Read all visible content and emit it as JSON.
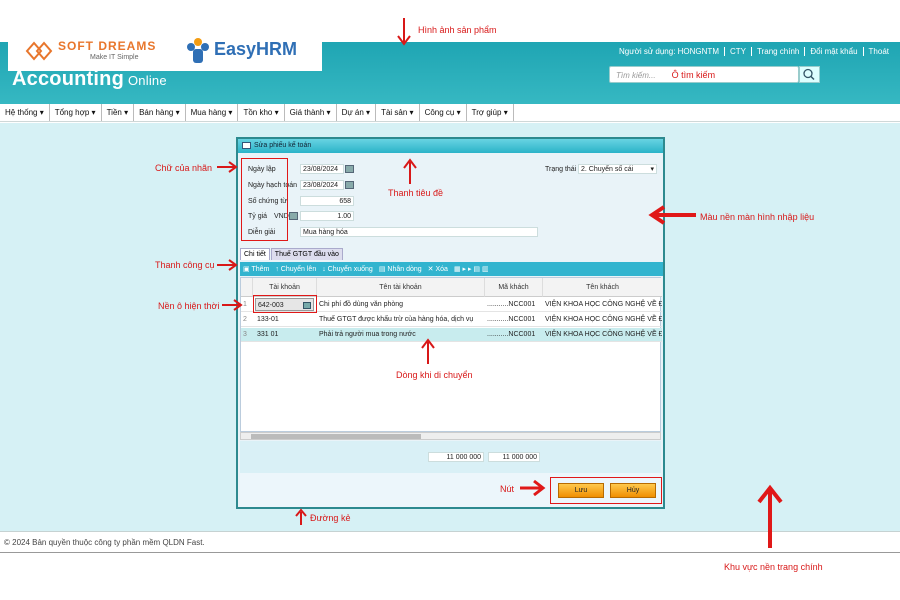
{
  "logos": {
    "softdreams_name": "SOFT DREAMS",
    "softdreams_tagline": "Make IT Simple",
    "easyhrm": "EasyHRM"
  },
  "header": {
    "app_title": "Accounting",
    "app_title_sub": "Online",
    "user_label": "Người sử dụng: HONGNTM",
    "links": [
      "CTY",
      "Trang chính",
      "Đổi mật khẩu",
      "Thoát"
    ],
    "search_placeholder": "Tìm kiếm...",
    "search_annotation_inline": "Ô tìm kiếm"
  },
  "menu": [
    "Hệ thống",
    "Tổng hợp",
    "Tiền",
    "Bán hàng",
    "Mua hàng",
    "Tồn kho",
    "Giá thành",
    "Dự án",
    "Tài sản",
    "Công cụ",
    "Trợ giúp"
  ],
  "dialog": {
    "title": "Sửa phiếu kế toán",
    "fields": {
      "ngay_lap_label": "Ngày lập",
      "ngay_lap": "23/08/2024",
      "ngay_hach_toan_label": "Ngày hạch toán",
      "ngay_hach_toan": "23/08/2024",
      "so_chung_tu_label": "Số chứng từ",
      "so_chung_tu": "658",
      "ty_gia_label": "Tỷ giá",
      "currency": "VND",
      "ty_gia": "1.00",
      "dien_giai_label": "Diễn giải",
      "dien_giai": "Mua hàng hóa",
      "trang_thai_label": "Trạng thái",
      "trang_thai": "2. Chuyển số cái"
    },
    "tabs": [
      "Chi tiết",
      "Thuế GTGT đầu vào"
    ],
    "toolbar": [
      "Thêm",
      "Chuyển lên",
      "Chuyển xuống",
      "Nhân dòng",
      "Xóa"
    ],
    "grid": {
      "headers": [
        "Tài khoản",
        "Tên tài khoản",
        "Mã khách",
        "Tên khách"
      ],
      "rows": [
        {
          "num": "1",
          "account": "642-003",
          "name": "Chi phí đồ dùng văn phòng",
          "cust": "...........NCC001",
          "cust_name": "VIỆN KHOA HỌC CÔNG NGHỆ VỀ ĐẦU"
        },
        {
          "num": "2",
          "account": "133-01",
          "name": "Thuế GTGT được khấu trừ của hàng hóa, dịch vụ",
          "cust": "...........NCC001",
          "cust_name": "VIỆN KHOA HỌC CÔNG NGHỆ VỀ ĐẦU"
        },
        {
          "num": "3",
          "account": "331 01",
          "name": "Phải trả người mua trong nước",
          "cust": "...........NCC001",
          "cust_name": "VIỆN KHOA HỌC CÔNG NGHỆ VỀ ĐẦU"
        }
      ]
    },
    "totals": [
      "11 000 000",
      "11 000 000"
    ],
    "buttons": {
      "save": "Lưu",
      "cancel": "Hủy"
    }
  },
  "footer": "© 2024 Bản quyền thuộc công ty phần mềm QLDN Fast.",
  "annotations": {
    "product_image": "Hình ảnh sản phẩm",
    "search_box": "Ô tìm kiếm",
    "label_text": "Chữ của nhãn",
    "title_bar": "Thanh tiêu đề",
    "input_bg": "Màu nền màn hình nhập liệu",
    "toolbar": "Thanh công cụ",
    "current_cell_bg": "Nền ô hiện thời",
    "moving_row": "Dòng khi di chuyển",
    "button": "Nút",
    "divider": "Đường kẻ",
    "main_bg_area": "Khu vực nền trang chính"
  },
  "colors": {
    "header": "#2bb0bc",
    "content_bg": "#d6f1f5",
    "toolbar": "#32b4cf",
    "annotation": "#d81818",
    "button": "#f5a623"
  }
}
